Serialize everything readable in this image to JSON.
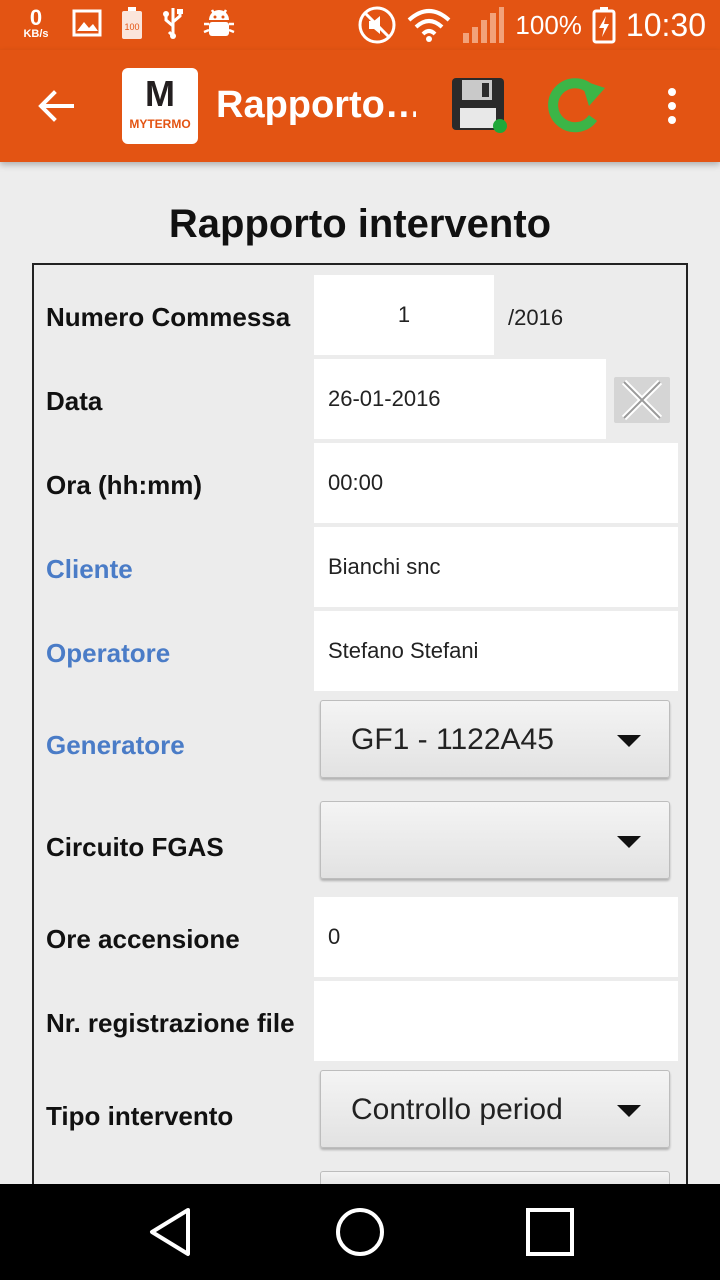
{
  "status_bar": {
    "speed_value": "0",
    "speed_unit": "KB/s",
    "icons": [
      "image-icon",
      "battery-100-icon",
      "usb-icon",
      "android-debug-icon",
      "mute-icon",
      "wifi-icon",
      "signal-icon",
      "battery-charging-icon"
    ],
    "battery": "100%",
    "time": "10:30"
  },
  "app_bar": {
    "title": "Rapporto…",
    "logo_mark": "M",
    "logo_text": "MYTERMO",
    "icons": [
      "back-arrow-icon",
      "save-icon",
      "refresh-icon",
      "more-vert-icon"
    ]
  },
  "page": {
    "title": "Rapporto intervento"
  },
  "form": {
    "numero_commessa": {
      "label": "Numero Commessa",
      "value": "1",
      "suffix": "/2016"
    },
    "data": {
      "label": "Data",
      "value": "26-01-2016"
    },
    "ora": {
      "label": "Ora (hh:mm)",
      "value": "00:00"
    },
    "cliente": {
      "label": "Cliente",
      "value": "Bianchi snc"
    },
    "operatore": {
      "label": "Operatore",
      "value": "Stefano Stefani"
    },
    "generatore": {
      "label": "Generatore",
      "value": "GF1 - 1122A45"
    },
    "circuito_fgas": {
      "label": "Circuito FGAS",
      "value": ""
    },
    "ore_accensione": {
      "label": "Ore accensione",
      "value": "0"
    },
    "nr_registrazione": {
      "label": "Nr. registrazione file",
      "value": ""
    },
    "tipo_intervento": {
      "label": "Tipo intervento",
      "value": "Controllo periodico"
    }
  },
  "colors": {
    "accent": "#e35413",
    "link": "#4a7cc7",
    "nav_background": "#000000"
  },
  "nav_bar": {
    "icons": [
      "back-triangle-icon",
      "home-circle-icon",
      "recents-square-icon"
    ]
  }
}
